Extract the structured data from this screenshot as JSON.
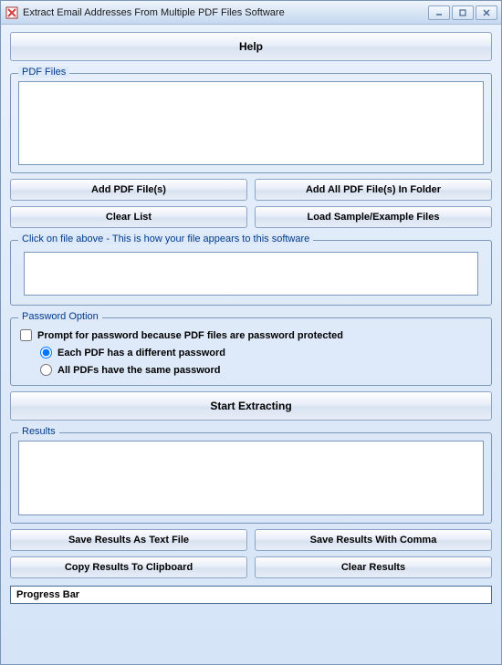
{
  "window": {
    "title": "Extract Email Addresses From Multiple PDF Files Software"
  },
  "buttons": {
    "help": "Help",
    "add_pdf": "Add PDF File(s)",
    "add_folder": "Add All PDF File(s) In Folder",
    "clear_list": "Clear List",
    "load_sample": "Load Sample/Example Files",
    "start": "Start Extracting",
    "save_text": "Save Results As Text File",
    "save_comma": "Save Results With Comma",
    "copy_clip": "Copy Results To Clipboard",
    "clear_results": "Clear Results"
  },
  "groups": {
    "pdf_files": "PDF Files",
    "preview": "Click on file above - This is how your file appears to this software",
    "password": "Password Option",
    "results": "Results"
  },
  "password": {
    "prompt_label": "Prompt for password because PDF files are password protected",
    "each_label": "Each PDF has a different password",
    "same_label": "All PDFs have the same password"
  },
  "progress": {
    "label": "Progress Bar"
  }
}
